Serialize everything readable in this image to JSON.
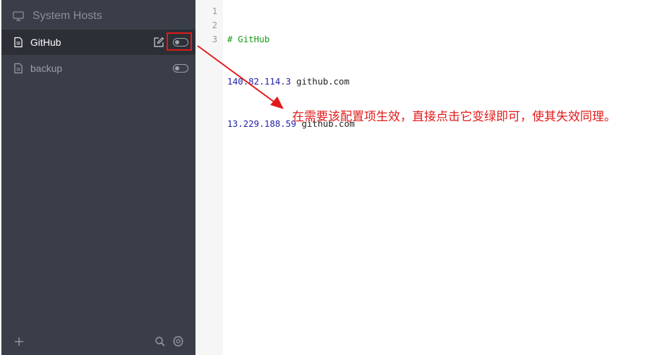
{
  "sidebar": {
    "system_hosts_label": "System Hosts",
    "items": [
      {
        "label": "GitHub",
        "active": true,
        "enabled": false
      },
      {
        "label": "backup",
        "active": false,
        "enabled": false
      }
    ],
    "footer": {
      "add_icon": "plus-icon",
      "search_icon": "search-icon",
      "settings_icon": "gear-icon"
    }
  },
  "editor": {
    "line_numbers": [
      "1",
      "2",
      "3"
    ],
    "lines": [
      {
        "comment": "# GitHub"
      },
      {
        "ip": "140.82.114.3",
        "host": " github.com"
      },
      {
        "ip": "13.229.188.59",
        "host": " github.com"
      }
    ]
  },
  "annotation": {
    "text": "在需要该配置项生效，直接点击它变绿即可，使其失效同理。",
    "color": "#e21a1a"
  },
  "colors": {
    "sidebar_bg": "#3a3e48",
    "active_row_bg": "#2c2f36",
    "comment": "#1a9a1a",
    "ip": "#1f1fa8",
    "highlight": "#e21a1a"
  }
}
